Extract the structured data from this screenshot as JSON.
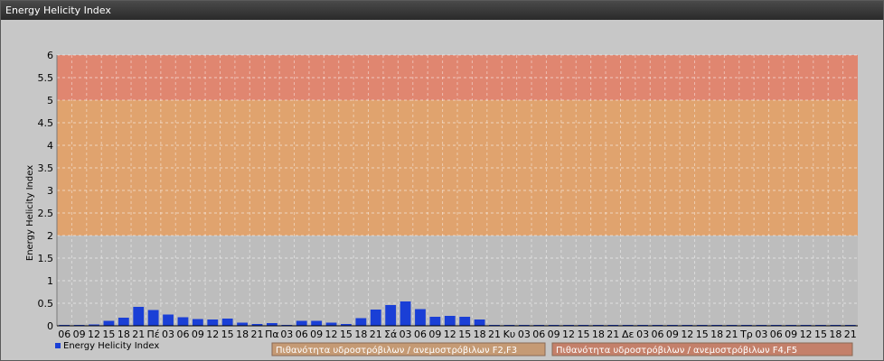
{
  "window": {
    "title": "Energy Helicity Index"
  },
  "chart_data": {
    "type": "bar",
    "ylabel": "Energy Helicity Index",
    "ylim": [
      0,
      6
    ],
    "yticks": [
      "0",
      "0.5",
      "1",
      "1.5",
      "2",
      "2.5",
      "3",
      "3.5",
      "4",
      "4.5",
      "5",
      "5.5",
      "6"
    ],
    "grid": true,
    "legend_position": "bottom-left",
    "categories": [
      "06",
      "09",
      "12",
      "15",
      "18",
      "21",
      "Πέ",
      "03",
      "06",
      "09",
      "12",
      "15",
      "18",
      "21",
      "Πα",
      "03",
      "06",
      "09",
      "12",
      "15",
      "18",
      "21",
      "Σά",
      "03",
      "06",
      "09",
      "12",
      "15",
      "18",
      "21",
      "Κυ",
      "03",
      "06",
      "09",
      "12",
      "15",
      "18",
      "21",
      "Δε",
      "03",
      "06",
      "09",
      "12",
      "15",
      "18",
      "21",
      "Τρ",
      "03",
      "06",
      "09",
      "12",
      "15",
      "18",
      "21"
    ],
    "series": [
      {
        "name": "Energy Helicity Index",
        "color": "#1a3fd6",
        "values": [
          0.02,
          0.02,
          0.03,
          0.11,
          0.18,
          0.42,
          0.35,
          0.25,
          0.19,
          0.15,
          0.14,
          0.16,
          0.07,
          0.04,
          0.06,
          0.02,
          0.11,
          0.11,
          0.07,
          0.04,
          0.17,
          0.36,
          0.46,
          0.54,
          0.37,
          0.2,
          0.22,
          0.2,
          0.14,
          0.01,
          0.01,
          0.01,
          0.01,
          0.01,
          0.01,
          0.01,
          0.01,
          0.01,
          0.01,
          0.01,
          0.01,
          0.01,
          0.01,
          0.01,
          0.01,
          0.01,
          0.01,
          0.01,
          0.01,
          0.01,
          0.01,
          0.01,
          0.01,
          0.01
        ]
      }
    ],
    "bands": [
      {
        "from": 0,
        "to": 2,
        "color": "#bdbdbd"
      },
      {
        "from": 2,
        "to": 5,
        "color": "#e0a36e",
        "label": "Πιθανότητα υδροστρόβιλων / ανεμοστρόβιλων F2,F3"
      },
      {
        "from": 5,
        "to": 6,
        "color": "#e08670",
        "label": "Πιθανότητα υδροστρόβιλων / ανεμοστρόβιλων F4,F5"
      }
    ],
    "band_legend_colors": [
      "#c59a74",
      "#c4806a"
    ]
  }
}
